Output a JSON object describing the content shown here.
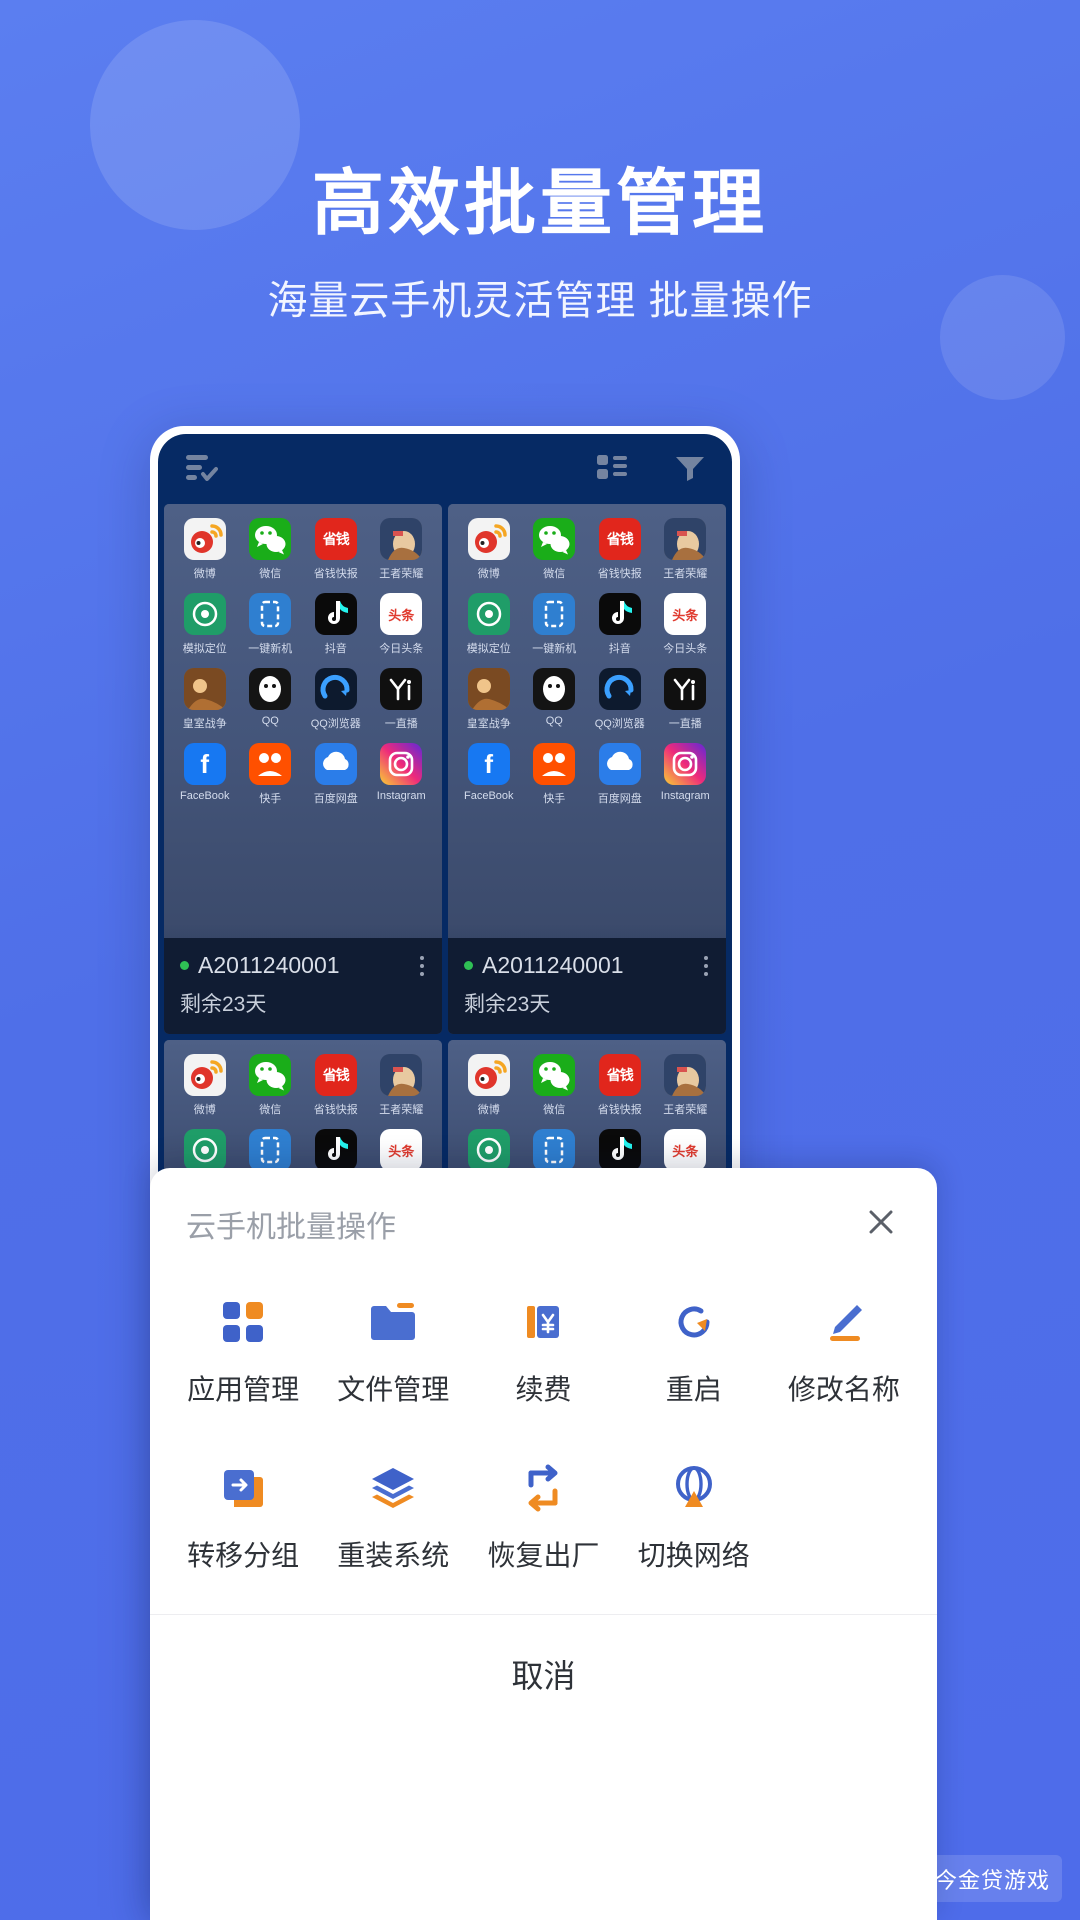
{
  "hero": {
    "title": "高效批量管理",
    "subtitle": "海量云手机灵活管理 批量操作"
  },
  "phone": {
    "topbar": {
      "select_all_icon": "list-check-icon",
      "layout_icon": "grid-layout-icon",
      "filter_icon": "funnel-filter-icon"
    },
    "apps": [
      {
        "label": "微博",
        "icon": "weibo-icon",
        "bg": "#f2f2f2"
      },
      {
        "label": "微信",
        "icon": "wechat-icon",
        "bg": "#1aad19"
      },
      {
        "label": "省钱快报",
        "icon": "shengqian-icon",
        "bg": "#e1261c"
      },
      {
        "label": "王者荣耀",
        "icon": "honor-king-icon",
        "bg": "#2b3a5c"
      },
      {
        "label": "模拟定位",
        "icon": "location-icon",
        "bg": "#1f9d68"
      },
      {
        "label": "一键新机",
        "icon": "newphone-icon",
        "bg": "#2f7fd0"
      },
      {
        "label": "抖音",
        "icon": "douyin-icon",
        "bg": "#0a0a0a"
      },
      {
        "label": "今日头条",
        "icon": "toutiao-icon",
        "bg": "#ffffff"
      },
      {
        "label": "皇室战争",
        "icon": "clashroyale-icon",
        "bg": "#8a5a2b"
      },
      {
        "label": "QQ",
        "icon": "qq-icon",
        "bg": "#1b1b1b"
      },
      {
        "label": "QQ浏览器",
        "icon": "qqbrowser-icon",
        "bg": "#0f1b2e"
      },
      {
        "label": "一直播",
        "icon": "yizhibo-icon",
        "bg": "#101010"
      },
      {
        "label": "FaceBook",
        "icon": "facebook-icon",
        "bg": "#1778f2"
      },
      {
        "label": "快手",
        "icon": "kuaishou-icon",
        "bg": "#ff5000"
      },
      {
        "label": "百度网盘",
        "icon": "baidupan-icon",
        "bg": "#2b7de9"
      },
      {
        "label": "Instagram",
        "icon": "instagram-icon",
        "bg": "#c13584"
      }
    ],
    "devices": [
      {
        "name": "A2011240001",
        "status": "剩余23天",
        "online": true
      },
      {
        "name": "A2011240001",
        "status": "剩余23天",
        "online": true
      }
    ]
  },
  "sheet": {
    "title": "云手机批量操作",
    "close_icon": "close-icon",
    "actions": [
      {
        "label": "应用管理",
        "icon": "apps-grid-icon"
      },
      {
        "label": "文件管理",
        "icon": "folder-icon"
      },
      {
        "label": "续费",
        "icon": "renew-yuan-icon"
      },
      {
        "label": "重启",
        "icon": "restart-icon"
      },
      {
        "label": "修改名称",
        "icon": "pencil-edit-icon"
      },
      {
        "label": "转移分组",
        "icon": "move-group-icon"
      },
      {
        "label": "重装系统",
        "icon": "layers-icon"
      },
      {
        "label": "恢复出厂",
        "icon": "factory-reset-icon"
      },
      {
        "label": "切换网络",
        "icon": "network-switch-icon"
      }
    ],
    "cancel_label": "取消"
  },
  "watermark": {
    "text": "今金贷游戏",
    "icon": "cube-logo-icon"
  },
  "colors": {
    "brand_blue": "#4f6fe8",
    "accent_blue": "#3f62c9",
    "accent_orange": "#e8912a",
    "sheet_bg": "#ffffff",
    "phone_dark": "#062a64",
    "online_green": "#2fbf55"
  }
}
